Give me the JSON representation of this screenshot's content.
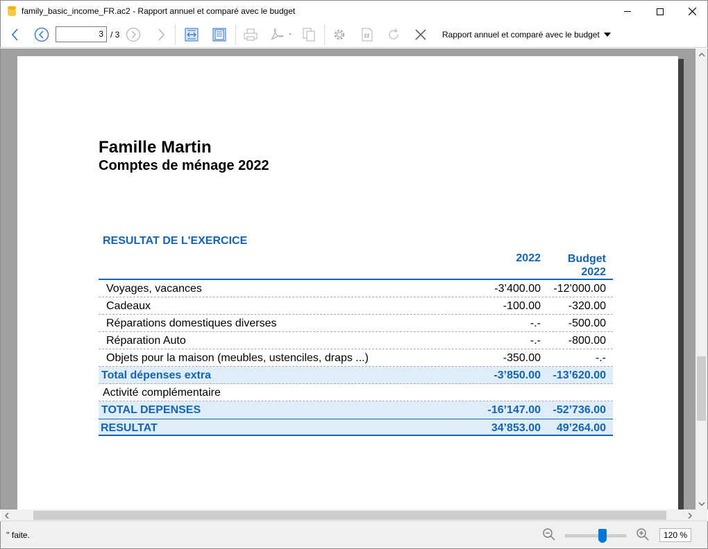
{
  "window": {
    "title": "family_basic_income_FR.ac2 - Rapport annuel et comparé avec le budget",
    "app_icon": "banana-app-icon"
  },
  "toolbar": {
    "current_page": "3",
    "page_total": "/ 3",
    "report_select": "Rapport annuel et comparé avec le budget",
    "icons": [
      "back-arrow-icon",
      "prev-page-icon",
      "next-page-icon",
      "forward-arrow-icon",
      "fit-width-icon",
      "fit-page-icon",
      "print-icon",
      "pdf-export-icon",
      "copy-icon",
      "settings-gear-icon",
      "page-number-icon",
      "refresh-icon",
      "close-icon"
    ]
  },
  "document": {
    "title": "Famille Martin",
    "subtitle": "Comptes de ménage 2022",
    "section_title": "RESULTAT DE L'EXERCICE",
    "col1_header": "2022",
    "col2_header_line1": "Budget",
    "col2_header_line2": "2022",
    "rows": [
      {
        "label": "Voyages, vacances",
        "v1": "-3’400.00",
        "v2": "-12’000.00"
      },
      {
        "label": "Cadeaux",
        "v1": "-100.00",
        "v2": "-320.00"
      },
      {
        "label": "Réparations domestiques diverses",
        "v1": "-.-",
        "v2": "-500.00"
      },
      {
        "label": "Réparation Auto",
        "v1": "-.-",
        "v2": "-800.00"
      },
      {
        "label": "Objets pour la maison (meubles, ustenciles, draps ...)",
        "v1": "-350.00",
        "v2": "-.-"
      }
    ],
    "total_extra": {
      "label": "Total dépenses extra",
      "v1": "-3’850.00",
      "v2": "-13’620.00"
    },
    "activite": {
      "label": "Activité complémentaire"
    },
    "total_depenses": {
      "label": "TOTAL DEPENSES",
      "v1": "-16’147.00",
      "v2": "-52’736.00"
    },
    "resultat": {
      "label": "RESULTAT",
      "v1": "34’853.00",
      "v2": "49’264.00"
    }
  },
  "status": {
    "text": "'' faite.",
    "zoom": "120 %",
    "zoom_level_percent": 120
  },
  "colors": {
    "accent": "#1464b4",
    "total_row_bg": "#deedf7",
    "viewer_bg": "#a0a0a0"
  }
}
